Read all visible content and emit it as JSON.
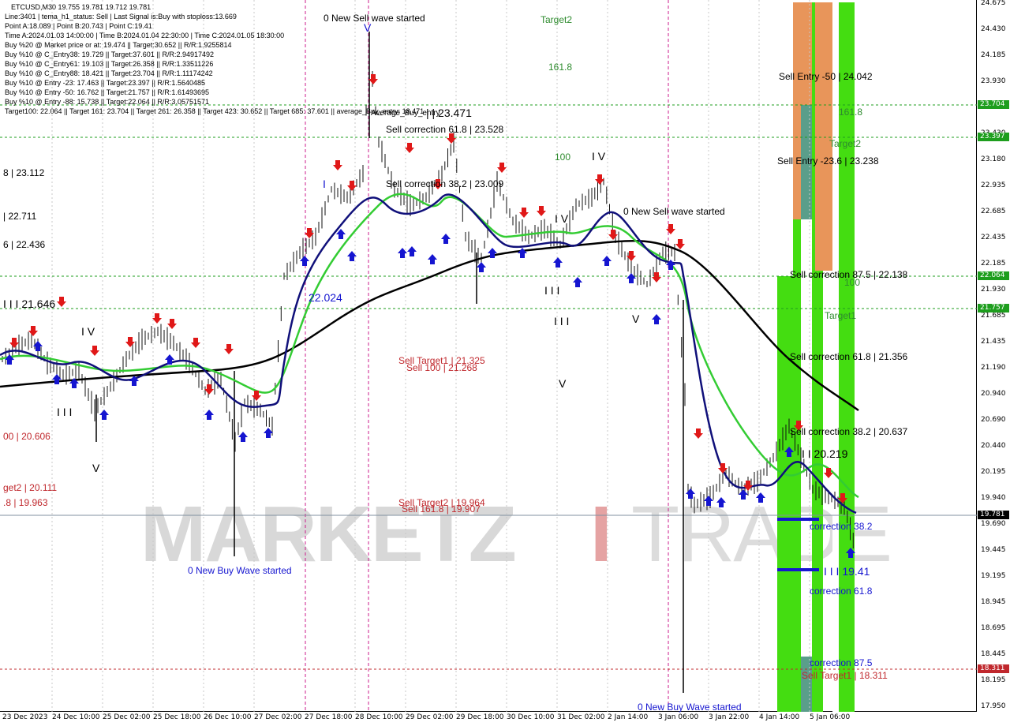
{
  "window": {
    "title_line": "ETCUSD,M30  19.755 19.781 19.712 19.781"
  },
  "info_lines": [
    "Line:3401 | tema_h1_status: Sell | Last Signal is:Buy with stoploss:13.669",
    "Point A:18.089 | Point B:20.743 | Point C:19.41",
    "Time A:2024.01.03 14:00:00 | Time B:2024.01.04 22:30:00 | Time C:2024.01.05 18:30:00",
    "Buy %20 @ Market price or at: 19.474 || Target:30.652 || R/R:1.9255814",
    "Buy %10 @ C_Entry38: 19.729 || Target:37.601 || R/R:2.94917492",
    "Buy %10 @ C_Entry61: 19.103 || Target:26.358 || R/R:1.33511226",
    "Buy %10 @ C_Entry88: 18.421 || Target:23.704 || R/R:1.11174242",
    "Buy %10 @ Entry -23: 17.463 || Target:23.397 || R/R:1.5640485",
    "Buy %10 @ Entry -50: 16.762 || Target:21.757 || R/R:1.61493695",
    "Buy %10 @ Entry -88: 15.738 || Target:22.064 || R/R:3.05751571",
    "Target100: 22.064 || Target 161: 23.704 || Target 261: 26.358 || Target 423: 30.652 || Target 685: 37.601 || average_Buy_entry: 18.471"
  ],
  "watermark": {
    "left": "MARKETZ",
    "sep": "I",
    "right": "TRADE"
  },
  "annotations": {
    "wave_sell_1": "0 New Sell wave started",
    "wave_sell_2": "0 New Sell wave started",
    "wave_buy_1": "0 New Buy Wave started",
    "wave_buy_2": "0 New Buy Wave started",
    "target2_top": "Target2",
    "fib_1618_top": "161.8",
    "fib_100_top": "100",
    "sell_corr_618_top": "Sell correction 61.8 | 23.528",
    "sell_corr_382_top": "Sell correction 38.2 | 23.009",
    "avg_buy": "Average_Buy_entry",
    "price_23471": "| | 23.471",
    "left_23112": "8 | 23.112",
    "left_22711": "| 22.711",
    "left_22436": "6 | 22.436",
    "left_21646": "I I I 21.646",
    "mid_22024": "22.024",
    "sell_target1_mid": "Sell Target1 | 21.325",
    "sell_100_mid": "Sell 100 | 21.268",
    "left_20606": "00 | 20.606",
    "left_target2": "get2 | 20.111",
    "left_19963": ".8 | 19.963",
    "sell_target2_mid": "Sell Target2 | 19.964",
    "sell_1618_mid": "Sell 161.8 | 19.907",
    "sell_entry_50": "Sell Entry -50 | 24.042",
    "sell_entry_236": "Sell Entry -23.6 | 23.238",
    "fib_1618_right": "161.8",
    "target2_right": "Target2",
    "sell_corr_875": "Sell correction 87.5 | 22.138",
    "fib_100_right": "100",
    "target1_right": "Target1",
    "sell_corr_618_right": "Sell correction 61.8 | 21.356",
    "sell_corr_382_right": "Sell correction 38.2 | 20.637",
    "price_20219": "I I 20.219",
    "corr_382": "correction 38.2",
    "price_1941": "I I I 19.41",
    "corr_618": "correction 61.8",
    "corr_875": "correction 87.5",
    "sell_target1_right": "Sell Target1 | 18.311",
    "wave_I_1": "I V",
    "wave_I_2": "I V",
    "wave_I_3": "I V",
    "wave_III_1": "I I I",
    "wave_III_2": "I I I",
    "wave_III_3": "I I I",
    "wave_V_1": "V",
    "wave_V_2": "V",
    "wave_V_3": "V",
    "wave_V_4": "V",
    "wave_I": "I",
    "wave_I_b": "I V"
  },
  "y_axis": {
    "ticks": [
      "24.675",
      "24.430",
      "24.185",
      "23.930",
      "23.685",
      "23.430",
      "23.180",
      "22.935",
      "22.685",
      "22.435",
      "22.185",
      "21.930",
      "21.685",
      "21.435",
      "21.190",
      "20.940",
      "20.690",
      "20.440",
      "20.195",
      "19.940",
      "19.690",
      "19.445",
      "19.195",
      "18.945",
      "18.695",
      "18.445",
      "18.195",
      "17.950"
    ],
    "badges": [
      {
        "text": "23.704",
        "color": "#1e9e1e"
      },
      {
        "text": "23.397",
        "color": "#1e9e1e"
      },
      {
        "text": "22.064",
        "color": "#1e9e1e"
      },
      {
        "text": "21.757",
        "color": "#1e9e1e"
      },
      {
        "text": "19.781",
        "color": "#000000"
      },
      {
        "text": "18.311",
        "color": "#c0282d"
      }
    ]
  },
  "x_axis": {
    "ticks": [
      "23 Dec 2023",
      "24 Dec 10:00",
      "25 Dec 02:00",
      "25 Dec 18:00",
      "26 Dec 10:00",
      "27 Dec 02:00",
      "27 Dec 18:00",
      "28 Dec 10:00",
      "29 Dec 02:00",
      "29 Dec 18:00",
      "30 Dec 10:00",
      "31 Dec 02:00",
      "2 Jan 14:00",
      "3 Jan 06:00",
      "3 Jan 22:00",
      "4 Jan 14:00",
      "5 Jan 06:00"
    ]
  },
  "colors": {
    "buy_arrow": "#1515d0",
    "sell_arrow": "#e01818",
    "ma_fast": "#10107a",
    "ma_mid": "#33cc33",
    "ma_slow": "#000000",
    "zone_green": "#44dd11",
    "zone_orange": "#e8955a",
    "zone_teal": "#5a9e8a"
  },
  "current_price": "19.781"
}
